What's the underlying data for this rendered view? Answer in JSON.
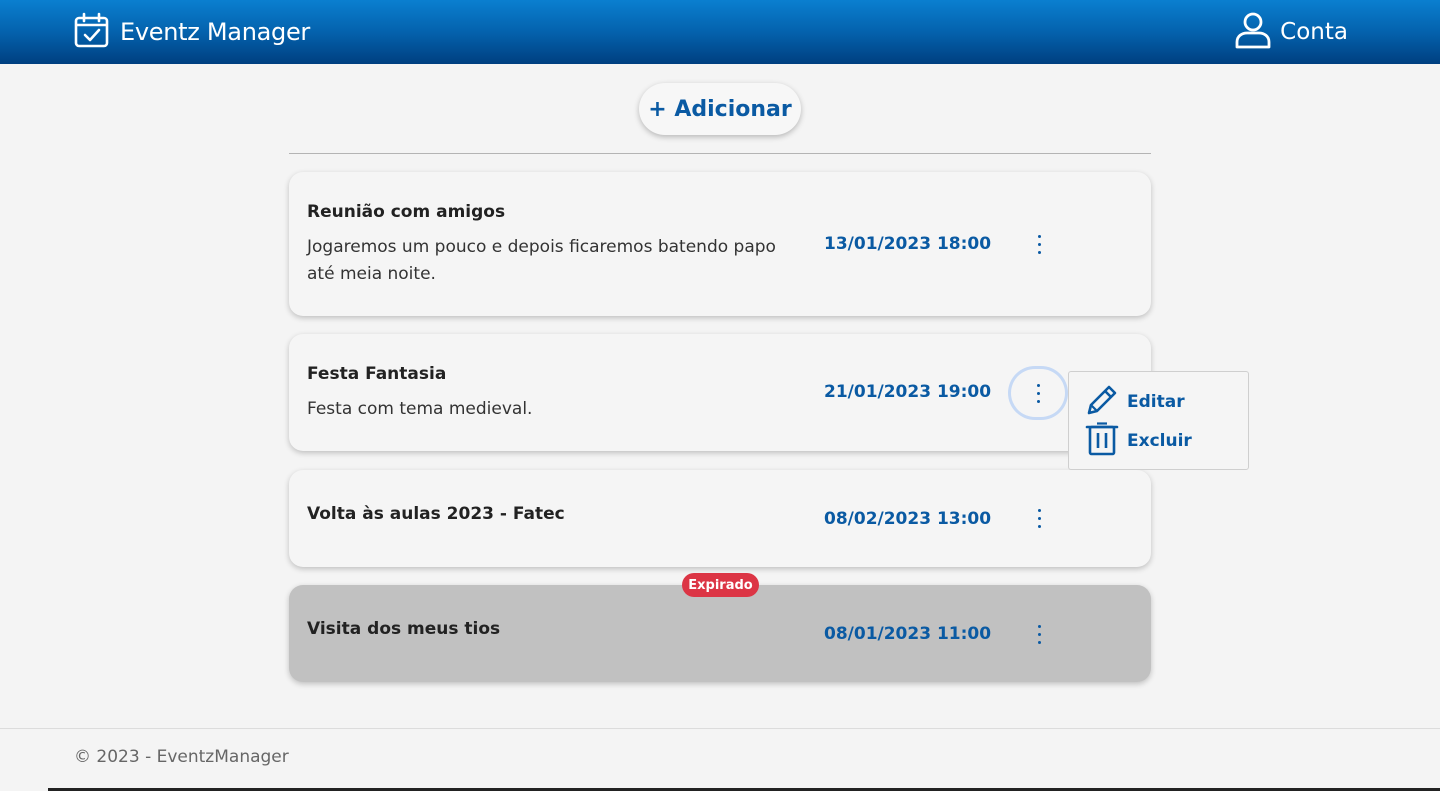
{
  "header": {
    "app_name": "Eventz Manager",
    "brand_icon": "calendar-check-icon",
    "account_label": "Conta",
    "account_icon": "user-icon"
  },
  "toolbar": {
    "add_label": "+ Adicionar"
  },
  "events": [
    {
      "title": "Reunião com amigos",
      "description": "Jogaremos um pouco e depois ficaremos batendo papo até meia noite.",
      "datetime": "13/01/2023 18:00",
      "expired": false
    },
    {
      "title": "Festa Fantasia",
      "description": "Festa com tema medieval.",
      "datetime": "21/01/2023 19:00",
      "expired": false
    },
    {
      "title": "Volta às aulas 2023 - Fatec",
      "description": "",
      "datetime": "08/02/2023 13:00",
      "expired": false
    },
    {
      "title": "Visita dos meus tios",
      "description": "",
      "datetime": "08/01/2023 11:00",
      "expired": true,
      "badge": "Expirado"
    }
  ],
  "context_menu": {
    "edit_label": "Editar",
    "edit_icon": "pencil-icon",
    "delete_label": "Excluir",
    "delete_icon": "trash-icon"
  },
  "footer": {
    "text": "© 2023 - EventzManager"
  },
  "colors": {
    "header_top": "#0a7fd0",
    "header_bottom": "#003f80",
    "accent": "#0a5aa3",
    "expired_badge": "#dc3545",
    "expired_card": "#c1c1c1"
  }
}
